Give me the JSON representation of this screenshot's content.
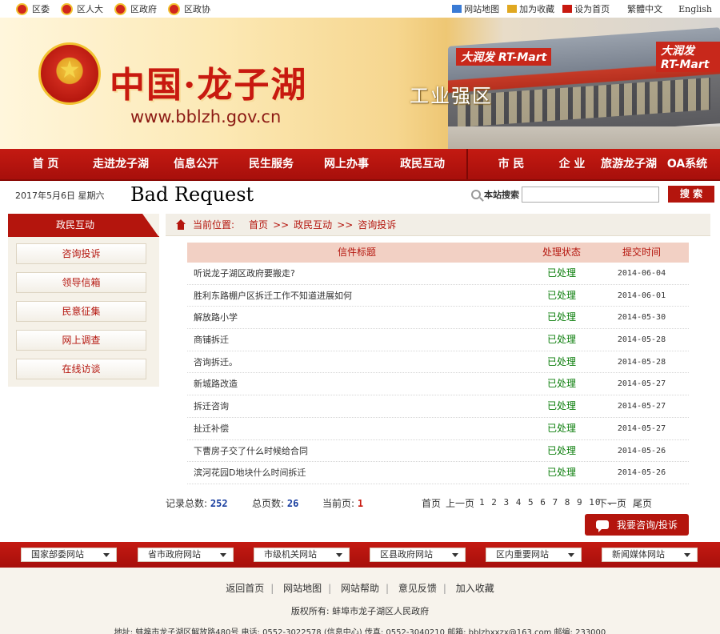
{
  "top_links": {
    "left": [
      "区委",
      "区人大",
      "区政府",
      "区政协"
    ],
    "right": [
      "网站地图",
      "加为收藏",
      "设为首页"
    ],
    "lang_trad": "繁體中文",
    "lang_en": "English"
  },
  "banner": {
    "title": "中国·龙子湖",
    "url": "www.bblzh.gov.cn",
    "slogan": "工业强区",
    "sign": "大润发 RT-Mart",
    "sign2": "大润发 RT-Mart"
  },
  "nav": [
    "首 页",
    "走进龙子湖",
    "信息公开",
    "民生服务",
    "网上办事",
    "政民互动",
    "市 民",
    "企 业",
    "旅游龙子湖",
    "OA系统"
  ],
  "info": {
    "date": "2017年5月6日 星期六",
    "error": "Bad Request",
    "search_label": "本站搜索",
    "search_button": "搜 索"
  },
  "left_panel": {
    "title": "政民互动",
    "items": [
      "咨询投诉",
      "领导信箱",
      "民意征集",
      "网上调查",
      "在线访谈"
    ]
  },
  "breadcrumb": {
    "label": "当前位置:",
    "items": [
      "首页",
      "政民互动",
      "咨询投诉"
    ],
    "sep": ">>"
  },
  "table": {
    "headers": [
      "信件标题",
      "处理状态",
      "提交时间"
    ],
    "rows": [
      {
        "title": "听说龙子湖区政府要搬走?",
        "status": "已处理",
        "date": "2014-06-04"
      },
      {
        "title": "胜利东路棚户区拆迁工作不知道进展如何",
        "status": "已处理",
        "date": "2014-06-01"
      },
      {
        "title": "解放路小学",
        "status": "已处理",
        "date": "2014-05-30"
      },
      {
        "title": "商铺拆迁",
        "status": "已处理",
        "date": "2014-05-28"
      },
      {
        "title": "咨询拆迁。",
        "status": "已处理",
        "date": "2014-05-28"
      },
      {
        "title": "新城路改造",
        "status": "已处理",
        "date": "2014-05-27"
      },
      {
        "title": "拆迁咨询",
        "status": "已处理",
        "date": "2014-05-27"
      },
      {
        "title": "扯迁补偿",
        "status": "已处理",
        "date": "2014-05-27"
      },
      {
        "title": "下曹房子交了什么时候给合同",
        "status": "已处理",
        "date": "2014-05-26"
      },
      {
        "title": "滨河花园D地块什么时间拆迁",
        "status": "已处理",
        "date": "2014-05-26"
      }
    ]
  },
  "pager": {
    "total_label": "记录总数:",
    "total": "252",
    "pages_label": "总页数:",
    "pages": "26",
    "current_label": "当前页:",
    "current": "1",
    "first": "首页",
    "prev": "上一页",
    "numbers": "1 2 3 4 5 6 7 8 9 10 . . .",
    "next": "下一页",
    "last": "尾页"
  },
  "ask_button": "我要咨询/投诉",
  "link_selects": [
    "国家部委网站",
    "省市政府网站",
    "市级机关网站",
    "区县政府网站",
    "区内重要网站",
    "新闻媒体网站"
  ],
  "footer": {
    "links": [
      "返回首页",
      "网站地图",
      "网站帮助",
      "意见反馈",
      "加入收藏"
    ],
    "copyright": "版权所有: 蚌埠市龙子湖区人民政府",
    "address": "地址: 蚌埠市龙子湖区解放路480号 电话: 0552-3022578 (信息中心) 传真: 0552-3040210 邮箱: bblzhxxzx@163.com 邮编: 233000"
  },
  "colors": {
    "brand_red": "#b4150d",
    "status_green": "#0a7d0a",
    "number_blue": "#1a3fa0"
  }
}
